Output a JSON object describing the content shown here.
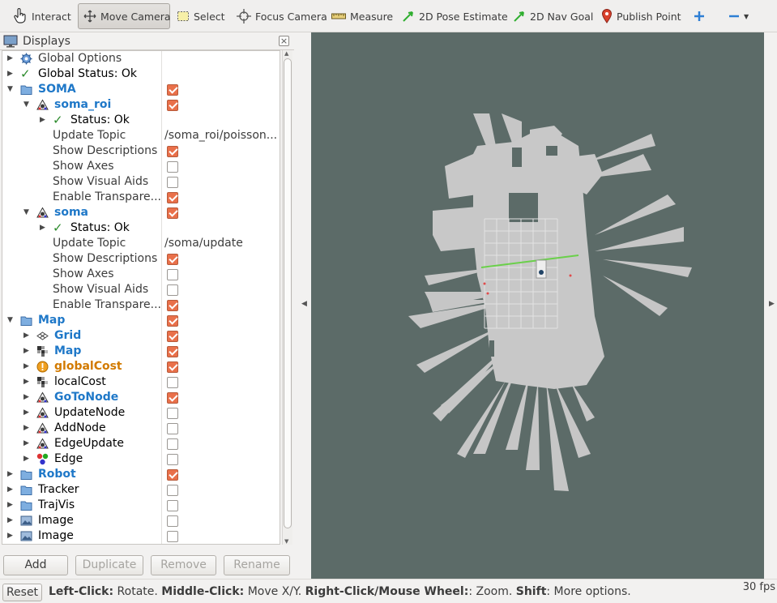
{
  "toolbar": {
    "interact": "Interact",
    "move_camera": "Move Camera",
    "select": "Select",
    "focus_camera": "Focus Camera",
    "measure": "Measure",
    "pose_estimate": "2D Pose Estimate",
    "nav_goal": "2D Nav Goal",
    "publish_point": "Publish Point"
  },
  "displays": {
    "title": "Displays",
    "close": "×",
    "rows": [
      {
        "label": "Global Options"
      },
      {
        "label": "Global Status: Ok"
      },
      {
        "label": "SOMA"
      },
      {
        "label": "soma_roi"
      },
      {
        "label": "Status: Ok"
      },
      {
        "label": "Update Topic",
        "value": "/soma_roi/poisson..."
      },
      {
        "label": "Show Descriptions"
      },
      {
        "label": "Show Axes"
      },
      {
        "label": "Show Visual Aids"
      },
      {
        "label": "Enable Transpare..."
      },
      {
        "label": "soma"
      },
      {
        "label": "Status: Ok"
      },
      {
        "label": "Update Topic",
        "value": "/soma/update"
      },
      {
        "label": "Show Descriptions"
      },
      {
        "label": "Show Axes"
      },
      {
        "label": "Show Visual Aids"
      },
      {
        "label": "Enable Transpare..."
      },
      {
        "label": "Map"
      },
      {
        "label": "Grid"
      },
      {
        "label": "Map"
      },
      {
        "label": "globalCost"
      },
      {
        "label": "localCost"
      },
      {
        "label": "GoToNode"
      },
      {
        "label": "UpdateNode"
      },
      {
        "label": "AddNode"
      },
      {
        "label": "EdgeUpdate"
      },
      {
        "label": "Edge"
      },
      {
        "label": "Robot"
      },
      {
        "label": "Tracker"
      },
      {
        "label": "TrajVis"
      },
      {
        "label": "Image"
      },
      {
        "label": "Image"
      }
    ]
  },
  "buttons": {
    "add": "Add",
    "duplicate": "Duplicate",
    "remove": "Remove",
    "rename": "Rename"
  },
  "statusbar": {
    "reset": "Reset",
    "left_click_key": "Left-Click:",
    "left_click_action": " Rotate. ",
    "middle_click_key": "Middle-Click:",
    "middle_click_action": " Move X/Y. ",
    "right_click_key": "Right-Click/Mouse Wheel:",
    "right_click_action": ": Zoom. ",
    "shift_key": "Shift",
    "shift_action": ": More options.",
    "fps": "30 fps"
  },
  "colors": {
    "viewport_bg": "#5c6b68",
    "checkbox_on": "#e9704a",
    "link_blue": "#1f78c8",
    "warning_orange": "#d27a00"
  }
}
